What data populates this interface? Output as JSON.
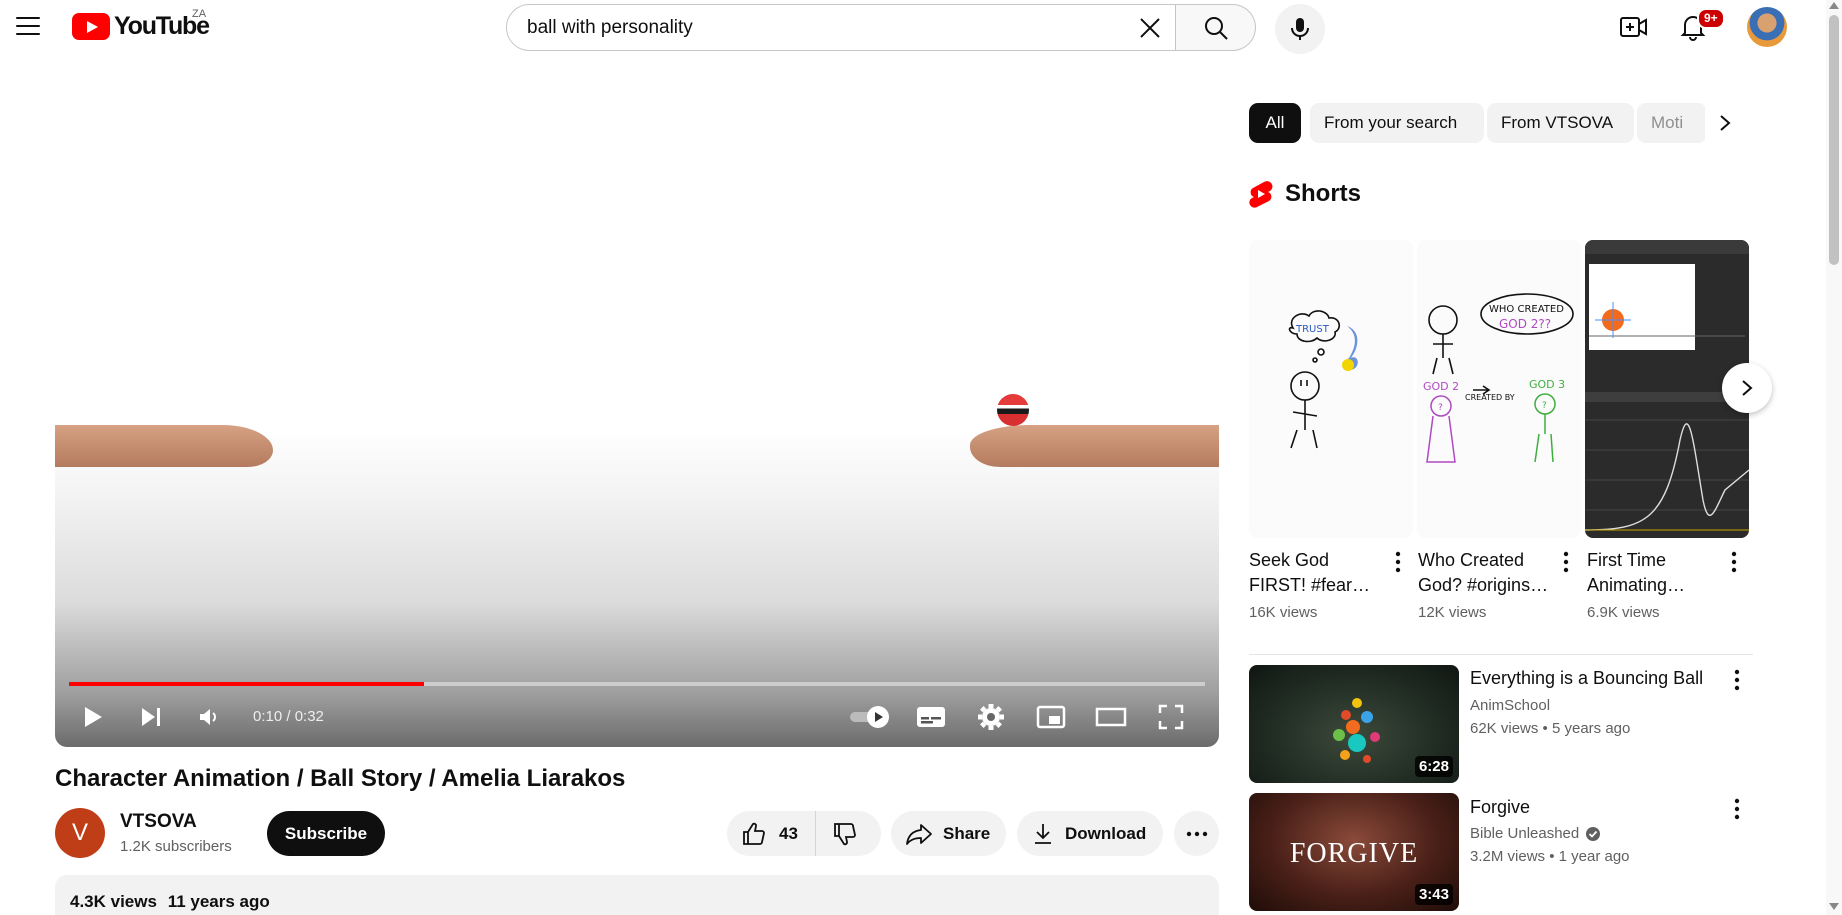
{
  "header": {
    "logo_text": "YouTube",
    "country_code": "ZA",
    "search_value": "ball with personality",
    "notifications_badge": "9+"
  },
  "player": {
    "current_time": "0:10",
    "duration": "0:32",
    "time_display": "0:10 / 0:32",
    "progress_fraction": 0.3125
  },
  "video": {
    "title": "Character Animation / Ball Story / Amelia Liarakos",
    "channel_initial": "V",
    "channel_name": "VTSOVA",
    "subscribers": "1.2K subscribers",
    "subscribe_label": "Subscribe",
    "like_count": "43",
    "share_label": "Share",
    "download_label": "Download",
    "views": "4.3K views",
    "age": "11 years ago"
  },
  "chips": [
    {
      "label": "All",
      "active": true
    },
    {
      "label": "From your search",
      "active": false
    },
    {
      "label": "From VTSOVA",
      "active": false
    },
    {
      "label": "Moti",
      "active": false
    }
  ],
  "shorts": {
    "title": "Shorts",
    "items": [
      {
        "title": "Seek God FIRST! #fear…",
        "views": "16K views"
      },
      {
        "title": "Who Created God? #origins…",
        "views": "12K views"
      },
      {
        "title": "First Time Animating…",
        "views": "6.9K views"
      }
    ]
  },
  "related": [
    {
      "title": "Everything is a Bouncing Ball",
      "channel": "AnimSchool",
      "views": "62K views",
      "age": "5 years ago",
      "duration": "6:28",
      "verified": false
    },
    {
      "title": "Forgive",
      "channel": "Bible Unleashed",
      "views": "3.2M views",
      "age": "1 year ago",
      "duration": "3:43",
      "verified": true,
      "thumb_text": "FORGIVE"
    }
  ],
  "sketch_text": {
    "trust": "TRUST",
    "who_created": "WHO CREATED",
    "god2": "GOD 2??",
    "created_by": "CREATED BY",
    "god2_label": "GOD 2",
    "god3_label": "GOD 3",
    "question": "?"
  },
  "colors": {
    "accent": "#ff0000",
    "notification": "#cc0000",
    "channel_avatar": "#c03e17"
  }
}
